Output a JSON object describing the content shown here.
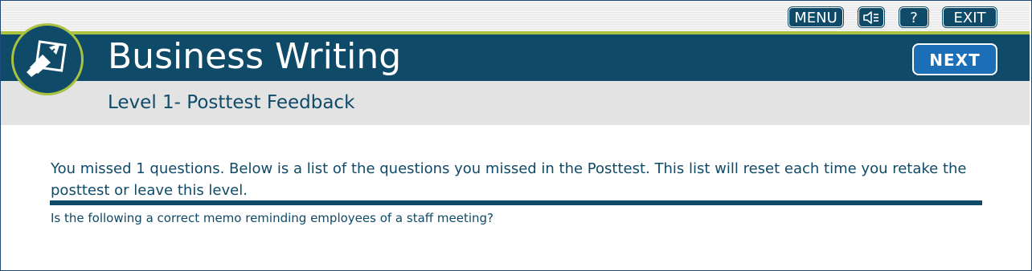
{
  "header": {
    "menu_label": "MENU",
    "help_label": "?",
    "exit_label": "EXIT",
    "audio_icon": "speaker-icon"
  },
  "course": {
    "title": "Business Writing",
    "subtitle": "Level 1- Posttest Feedback",
    "next_label": "NEXT",
    "logo_icon": "pen-hand-icon"
  },
  "content": {
    "message": "You missed 1 questions. Below is a list of the questions you missed in the Posttest. This list will reset each time you retake the posttest or leave this level.",
    "missed_questions": [
      "Is the following a correct memo reminding employees of a staff meeting?"
    ]
  },
  "colors": {
    "primary": "#0f4a68",
    "accent_green": "#a9c23f",
    "next_button": "#1a6fb7",
    "subheader_bg": "#e3e3e3"
  }
}
